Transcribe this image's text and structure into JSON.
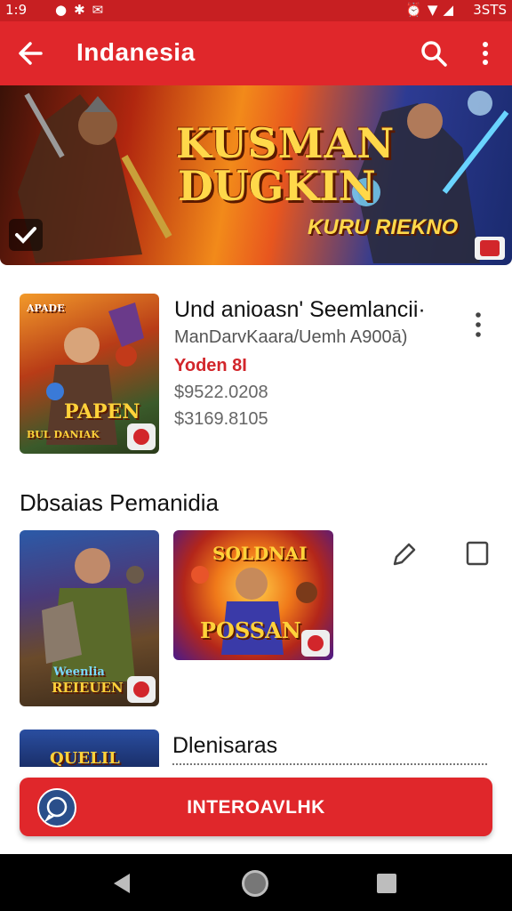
{
  "status_bar": {
    "time": "1:9",
    "left_icons": [
      "circle-notification-icon",
      "bluetooth-icon",
      "mail-icon"
    ],
    "right_icons": [
      "alarm-icon",
      "wifi-icon",
      "signal-icon"
    ],
    "battery": "3STS"
  },
  "app_bar": {
    "title": "Indanesia",
    "back_icon": "arrow-left-icon",
    "search_icon": "search-icon",
    "more_icon": "more-vert-icon"
  },
  "hero": {
    "title_line1": "KUSMAN",
    "title_line2": "DUGKIN",
    "subtitle": "KURU RIEKNO"
  },
  "featured": {
    "thumb_text": "PAPEN",
    "thumb_top_text": "APADE",
    "thumb_bottom_text": "BUL DANIAK",
    "title": "Und anioasn' Seemlancii·",
    "subtitle": "ManDarvKaara/Uemh A900ā)",
    "tag": "Yoden 8I",
    "price1": "$9522.0208",
    "price2": "$3169.8105"
  },
  "section": {
    "title": "Dbsaias Pemanidia"
  },
  "games": [
    {
      "thumb_text": "Weenlia",
      "thumb_text2": "REIEUEN"
    },
    {
      "thumb_text": "SOLDNAI",
      "thumb_text2": "POSSAN"
    }
  ],
  "partial_item": {
    "thumb_text": "QUELIL",
    "title": "Dlenisaras"
  },
  "cta": {
    "label": "INTEROAVLHK"
  },
  "nav_bar": {
    "icons": [
      "back-triangle-icon",
      "home-circle-icon",
      "recents-square-icon"
    ]
  },
  "colors": {
    "primary": "#e0272b",
    "status_bar": "#c71f22",
    "tag_red": "#d2262b"
  }
}
